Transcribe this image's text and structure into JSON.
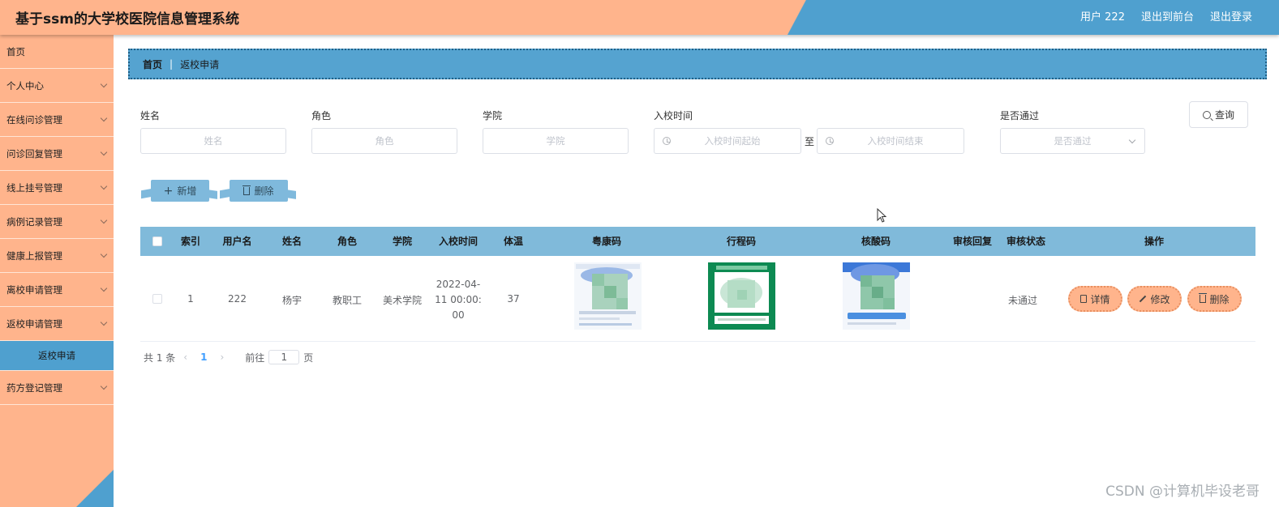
{
  "app": {
    "title": "基于ssm的大学校医院信息管理系统"
  },
  "topnav": {
    "user": "用户 222",
    "front": "退出到前台",
    "logout": "退出登录"
  },
  "sidebar": {
    "items": [
      {
        "label": "首页"
      },
      {
        "label": "个人中心"
      },
      {
        "label": "在线问诊管理"
      },
      {
        "label": "问诊回复管理"
      },
      {
        "label": "线上挂号管理"
      },
      {
        "label": "病例记录管理"
      },
      {
        "label": "健康上报管理"
      },
      {
        "label": "离校申请管理"
      },
      {
        "label": "返校申请管理"
      },
      {
        "label": "返校申请"
      },
      {
        "label": "药方登记管理"
      }
    ]
  },
  "breadcrumb": {
    "home": "首页",
    "sep": "|",
    "current": "返校申请"
  },
  "search": {
    "name_label": "姓名",
    "name_placeholder": "姓名",
    "role_label": "角色",
    "role_placeholder": "角色",
    "college_label": "学院",
    "college_placeholder": "学院",
    "time_label": "入校时间",
    "time_start_placeholder": "入校时间起始",
    "time_end_placeholder": "入校时间结束",
    "time_sep": "至",
    "passed_label": "是否通过",
    "passed_placeholder": "是否通过",
    "query_label": "查询"
  },
  "actions": {
    "add_label": "新增",
    "delete_label": "删除"
  },
  "table": {
    "columns": [
      "索引",
      "用户名",
      "姓名",
      "角色",
      "学院",
      "入校时间",
      "体温",
      "粤康码",
      "行程码",
      "核酸码",
      "审核回复",
      "审核状态",
      "操作"
    ],
    "rows": [
      {
        "index": "1",
        "username": "222",
        "name": "杨宇",
        "role": "教职工",
        "college": "美术学院",
        "time_line1": "2022-04-",
        "time_line2": "11 00:00:",
        "time_line3": "00",
        "temperature": "37",
        "reply": "",
        "status": "未通过",
        "detail_label": "详情",
        "edit_label": "修改",
        "delete_label": "删除"
      }
    ]
  },
  "pagination": {
    "total": "共 1 条",
    "prev": "‹",
    "page": "1",
    "next": "›",
    "goto_label": "前往",
    "goto_value": "1",
    "page_unit": "页"
  },
  "watermark": "CSDN @计算机毕设老哥",
  "colors": {
    "peach": "#ffb48c",
    "blue": "#4fa0cf",
    "table_header": "#80bada"
  }
}
